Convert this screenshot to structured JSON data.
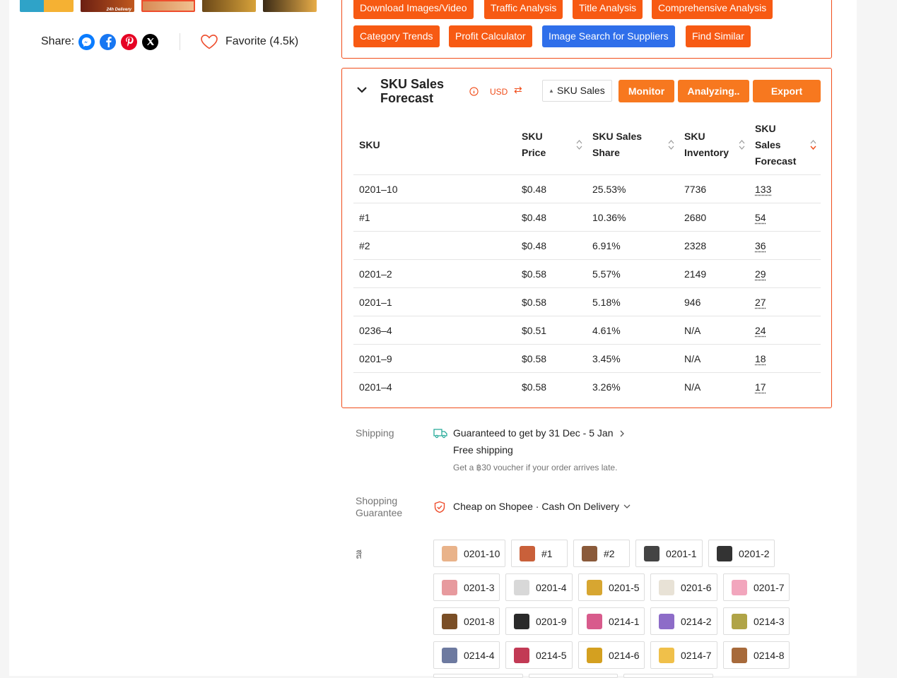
{
  "gallery": {
    "thumbnails": [
      {
        "name": "thumb-1",
        "colors": [
          "#2fa3c8",
          "#f5b133"
        ],
        "caption": ""
      },
      {
        "name": "thumb-2",
        "colors": [
          "#6b1f12",
          "#c0581e"
        ],
        "caption": "24h Delivery"
      },
      {
        "name": "thumb-3",
        "colors": [
          "#d88a55",
          "#f1c08f"
        ],
        "caption": ""
      },
      {
        "name": "thumb-4",
        "colors": [
          "#6a4718",
          "#d7a23a"
        ],
        "caption": ""
      },
      {
        "name": "thumb-5",
        "colors": [
          "#3a2a16",
          "#e8ad48"
        ],
        "caption": ""
      }
    ]
  },
  "share": {
    "label": "Share:"
  },
  "favorite": {
    "label": "Favorite (4.5k)"
  },
  "tools": {
    "row1": [
      "Download Images/Video",
      "Traffic Analysis",
      "Title Analysis",
      "Comprehensive Analysis"
    ],
    "row2": [
      "Category Trends",
      "Profit Calculator",
      "Image Search for Suppliers",
      "Find Similar"
    ]
  },
  "sku_panel": {
    "title": "SKU Sales Forecast",
    "currency": "USD",
    "selector_value": "SKU Sales",
    "monitor_label": "Monitor",
    "analyzing_label": "Analyzing..",
    "export_label": "Export",
    "columns": [
      "SKU",
      "SKU Price",
      "SKU Sales Share",
      "SKU Inventory",
      "SKU Sales Forecast"
    ],
    "rows": [
      [
        "0201–10",
        "$0.48",
        "25.53%",
        "7736",
        "133"
      ],
      [
        "#1",
        "$0.48",
        "10.36%",
        "2680",
        "54"
      ],
      [
        "#2",
        "$0.48",
        "6.91%",
        "2328",
        "36"
      ],
      [
        "0201–2",
        "$0.58",
        "5.57%",
        "2149",
        "29"
      ],
      [
        "0201–1",
        "$0.58",
        "5.18%",
        "946",
        "27"
      ],
      [
        "0236–4",
        "$0.51",
        "4.61%",
        "N/A",
        "24"
      ],
      [
        "0201–9",
        "$0.58",
        "3.45%",
        "N/A",
        "18"
      ],
      [
        "0201–4",
        "$0.58",
        "3.26%",
        "N/A",
        "17"
      ]
    ]
  },
  "shipping": {
    "label": "Shipping",
    "guarantee": "Guaranteed to get by 31 Dec - 5 Jan",
    "free": "Free shipping",
    "voucher": "Get a ฿30 voucher if your order arrives late."
  },
  "shopping_guarantee": {
    "label": "Shopping Guarantee",
    "value": "Cheap on Shopee · Cash On Delivery"
  },
  "variation": {
    "label": "สี",
    "options": [
      "0201-10",
      "#1",
      "#2",
      "0201-1",
      "0201-2",
      "0201-3",
      "0201-4",
      "0201-5",
      "0201-6",
      "0201-7",
      "0201-8",
      "0201-9",
      "0214-1",
      "0214-2",
      "0214-3",
      "0214-4",
      "0214-5",
      "0214-6",
      "0214-7",
      "0214-8"
    ],
    "swatch_colors": [
      "#e9b38a",
      "#c9603a",
      "#8a5a3a",
      "#444444",
      "#333333",
      "#e79a9e",
      "#d8d8d8",
      "#d7a631",
      "#e8e2d6",
      "#f2a6bd",
      "#7a4e26",
      "#2a2a2a",
      "#d85b8c",
      "#8d6cc8",
      "#b0a447",
      "#6d7aa0",
      "#c23a55",
      "#d4a020",
      "#f0c04a",
      "#a76a3b"
    ]
  }
}
